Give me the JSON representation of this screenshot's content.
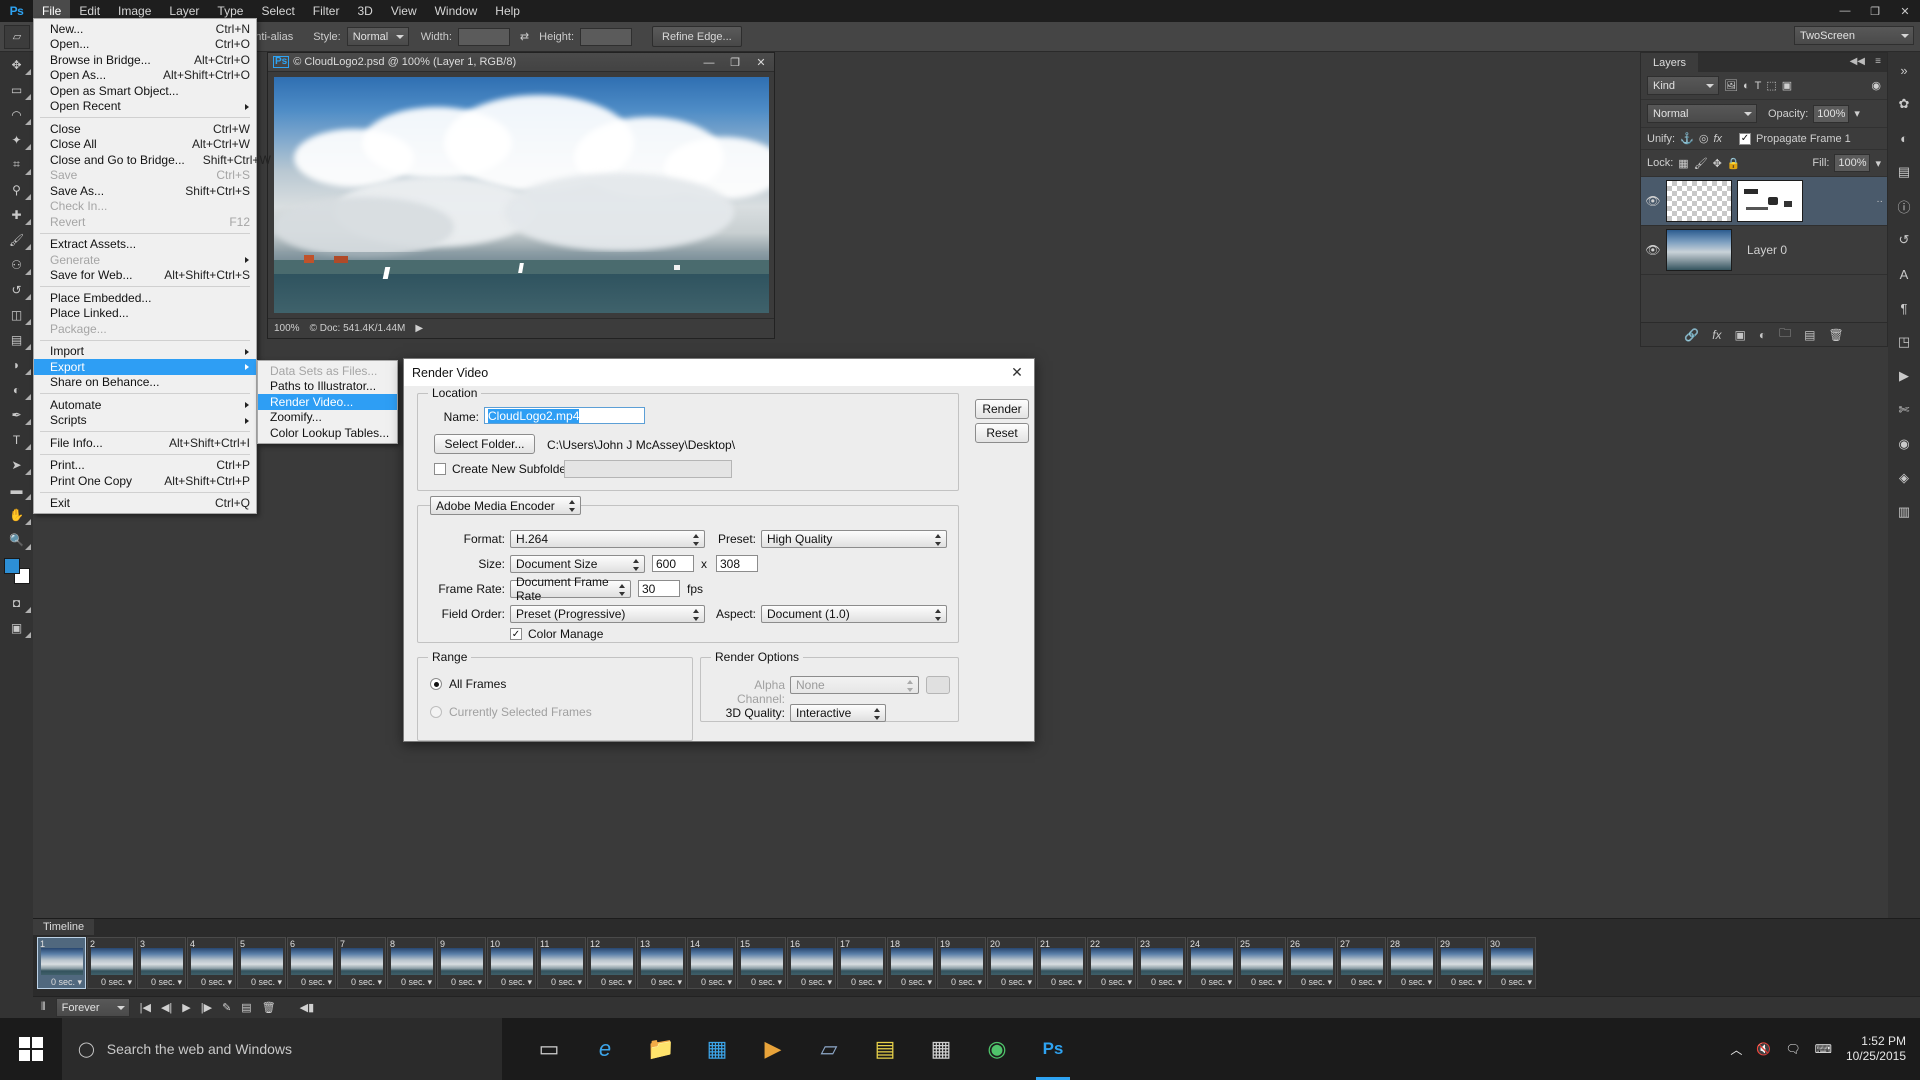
{
  "app": {
    "name": "Adobe Photoshop",
    "logo": "Ps"
  },
  "menubar": {
    "items": [
      "File",
      "Edit",
      "Image",
      "Layer",
      "Type",
      "Select",
      "Filter",
      "3D",
      "View",
      "Window",
      "Help"
    ],
    "active": "File",
    "window_buttons": [
      "minimize",
      "restore",
      "close"
    ]
  },
  "options_bar": {
    "antialias_label": "Anti-alias",
    "style_label": "Style:",
    "style_value": "Normal",
    "width_label": "Width:",
    "width_value": "",
    "height_label": "Height:",
    "height_value": "",
    "refine_edge_label": "Refine Edge...",
    "workspace_value": "TwoScreen"
  },
  "file_menu": {
    "groups": [
      [
        {
          "label": "New...",
          "accel": "Ctrl+N",
          "disabled": false,
          "submenu": false
        },
        {
          "label": "Open...",
          "accel": "Ctrl+O",
          "disabled": false,
          "submenu": false
        },
        {
          "label": "Browse in Bridge...",
          "accel": "Alt+Ctrl+O",
          "disabled": false,
          "submenu": false
        },
        {
          "label": "Open As...",
          "accel": "Alt+Shift+Ctrl+O",
          "disabled": false,
          "submenu": false
        },
        {
          "label": "Open as Smart Object...",
          "accel": "",
          "disabled": false,
          "submenu": false
        },
        {
          "label": "Open Recent",
          "accel": "",
          "disabled": false,
          "submenu": true
        }
      ],
      [
        {
          "label": "Close",
          "accel": "Ctrl+W",
          "disabled": false,
          "submenu": false
        },
        {
          "label": "Close All",
          "accel": "Alt+Ctrl+W",
          "disabled": false,
          "submenu": false
        },
        {
          "label": "Close and Go to Bridge...",
          "accel": "Shift+Ctrl+W",
          "disabled": false,
          "submenu": false
        },
        {
          "label": "Save",
          "accel": "Ctrl+S",
          "disabled": true,
          "submenu": false
        },
        {
          "label": "Save As...",
          "accel": "Shift+Ctrl+S",
          "disabled": false,
          "submenu": false
        },
        {
          "label": "Check In...",
          "accel": "",
          "disabled": true,
          "submenu": false
        },
        {
          "label": "Revert",
          "accel": "F12",
          "disabled": true,
          "submenu": false
        }
      ],
      [
        {
          "label": "Extract Assets...",
          "accel": "",
          "disabled": false,
          "submenu": false
        },
        {
          "label": "Generate",
          "accel": "",
          "disabled": true,
          "submenu": true
        },
        {
          "label": "Save for Web...",
          "accel": "Alt+Shift+Ctrl+S",
          "disabled": false,
          "submenu": false
        }
      ],
      [
        {
          "label": "Place Embedded...",
          "accel": "",
          "disabled": false,
          "submenu": false
        },
        {
          "label": "Place Linked...",
          "accel": "",
          "disabled": false,
          "submenu": false
        },
        {
          "label": "Package...",
          "accel": "",
          "disabled": true,
          "submenu": false
        }
      ],
      [
        {
          "label": "Import",
          "accel": "",
          "disabled": false,
          "submenu": true
        },
        {
          "label": "Export",
          "accel": "",
          "disabled": false,
          "submenu": true,
          "highlighted": true
        },
        {
          "label": "Share on Behance...",
          "accel": "",
          "disabled": false,
          "submenu": false
        }
      ],
      [
        {
          "label": "Automate",
          "accel": "",
          "disabled": false,
          "submenu": true
        },
        {
          "label": "Scripts",
          "accel": "",
          "disabled": false,
          "submenu": true
        }
      ],
      [
        {
          "label": "File Info...",
          "accel": "Alt+Shift+Ctrl+I",
          "disabled": false,
          "submenu": false
        }
      ],
      [
        {
          "label": "Print...",
          "accel": "Ctrl+P",
          "disabled": false,
          "submenu": false
        },
        {
          "label": "Print One Copy",
          "accel": "Alt+Shift+Ctrl+P",
          "disabled": false,
          "submenu": false
        }
      ],
      [
        {
          "label": "Exit",
          "accel": "Ctrl+Q",
          "disabled": false,
          "submenu": false
        }
      ]
    ]
  },
  "export_submenu": {
    "items": [
      {
        "label": "Data Sets as Files...",
        "disabled": true,
        "highlighted": false
      },
      {
        "label": "Paths to Illustrator...",
        "disabled": false,
        "highlighted": false
      },
      {
        "label": "Render Video...",
        "disabled": false,
        "highlighted": true
      },
      {
        "label": "Zoomify...",
        "disabled": false,
        "highlighted": false
      },
      {
        "label": "Color Lookup Tables...",
        "disabled": false,
        "highlighted": false
      }
    ]
  },
  "document_window": {
    "title": "© CloudLogo2.psd @ 100% (Layer 1, RGB/8)",
    "badge": "Ps",
    "zoom": "100%",
    "doc_info": "© Doc: 541.4K/1.44M",
    "window_buttons": [
      "minimize",
      "restore",
      "close"
    ]
  },
  "layers_panel": {
    "tab_label": "Layers",
    "filter_kind": "Kind",
    "filter_icons": [
      "image-filter-icon",
      "adjustment-filter-icon",
      "type-filter-icon",
      "shape-filter-icon",
      "smart-object-filter-icon"
    ],
    "blend_mode": "Normal",
    "opacity_label": "Opacity:",
    "opacity_value": "100%",
    "unify_label": "Unify:",
    "unify_icons": [
      "unify-position-icon",
      "unify-visibility-icon",
      "unify-style-icon"
    ],
    "propagate_label": "Propagate Frame 1",
    "propagate_checked": true,
    "lock_label": "Lock:",
    "lock_icons": [
      "lock-transparent-icon",
      "lock-image-icon",
      "lock-position-icon",
      "lock-all-icon"
    ],
    "fill_label": "Fill:",
    "fill_value": "100%",
    "layers": [
      {
        "name": "",
        "selected": true,
        "visible": true,
        "thumb": "transparent",
        "has_mask": true
      },
      {
        "name": "Layer 0",
        "selected": false,
        "visible": true,
        "thumb": "photo",
        "has_mask": false
      }
    ],
    "footer_icons": [
      "link-layers-icon",
      "layer-style-icon",
      "layer-mask-icon",
      "adjustment-layer-icon",
      "new-group-icon",
      "new-layer-icon",
      "delete-layer-icon"
    ]
  },
  "dialog": {
    "title": "Render Video",
    "close_icon": "close-icon",
    "buttons": {
      "render": "Render",
      "reset": "Reset"
    },
    "location": {
      "group_title": "Location",
      "name_label": "Name:",
      "name_value": "CloudLogo2.mp4",
      "select_folder_label": "Select Folder...",
      "folder_path": "C:\\Users\\John J McAssey\\Desktop\\",
      "create_subfolder_label": "Create New Subfolder:",
      "create_subfolder_checked": false,
      "subfolder_value": ""
    },
    "encoder": {
      "engine": "Adobe Media Encoder",
      "format_label": "Format:",
      "format_value": "H.264",
      "preset_label": "Preset:",
      "preset_value": "High Quality",
      "size_label": "Size:",
      "size_value": "Document Size",
      "width_value": "600",
      "size_separator": "x",
      "height_value": "308",
      "frame_rate_label": "Frame Rate:",
      "frame_rate_value": "Document Frame Rate",
      "fps_value": "30",
      "fps_unit": "fps",
      "field_order_label": "Field Order:",
      "field_order_value": "Preset (Progressive)",
      "aspect_label": "Aspect:",
      "aspect_value": "Document (1.0)",
      "color_manage_label": "Color Manage",
      "color_manage_checked": true
    },
    "range": {
      "group_title": "Range",
      "options": [
        {
          "label": "All Frames",
          "selected": true,
          "disabled": false
        },
        {
          "label": "Currently Selected Frames",
          "selected": false,
          "disabled": true
        }
      ]
    },
    "render_options": {
      "group_title": "Render Options",
      "alpha_label": "Alpha Channel:",
      "alpha_value": "None",
      "alpha_disabled": true,
      "quality_label": "3D Quality:",
      "quality_value": "Interactive"
    }
  },
  "timeline": {
    "tab_label": "Timeline",
    "frame_count": 30,
    "selected_frame": 1,
    "frame_duration": "0 sec.",
    "loop_value": "Forever",
    "controls": [
      "select-first-frame-icon",
      "previous-frame-icon",
      "play-icon",
      "next-frame-icon",
      "tween-icon",
      "duplicate-frame-icon",
      "delete-frame-icon"
    ]
  },
  "taskbar": {
    "start_icon": "windows-start-icon",
    "search_placeholder": "Search the web and Windows",
    "search_icon": "search-icon",
    "apps": [
      {
        "name": "task-view-icon",
        "glyph": "▭",
        "active": false
      },
      {
        "name": "edge-browser-icon",
        "glyph": "e",
        "active": false
      },
      {
        "name": "file-explorer-icon",
        "glyph": "📁",
        "active": false
      },
      {
        "name": "store-icon",
        "glyph": "▦",
        "active": false
      },
      {
        "name": "media-player-icon",
        "glyph": "▶",
        "active": false
      },
      {
        "name": "video-editor-icon",
        "glyph": "▱",
        "active": false
      },
      {
        "name": "notes-icon",
        "glyph": "▤",
        "active": false
      },
      {
        "name": "calculator-icon",
        "glyph": "▦",
        "active": false
      },
      {
        "name": "chrome-icon",
        "glyph": "◉",
        "active": false
      },
      {
        "name": "photoshop-icon",
        "glyph": "Ps",
        "active": true
      }
    ],
    "tray": {
      "show_hidden_icon": "chevron-up-icon",
      "volume_icon": "volume-muted-icon",
      "action_center_icon": "notification-icon",
      "keyboard_icon": "keyboard-icon",
      "time": "1:52 PM",
      "date": "10/25/2015"
    }
  },
  "tools": [
    "move-tool",
    "marquee-tool",
    "lasso-tool",
    "quick-select-tool",
    "crop-tool",
    "eyedropper-tool",
    "healing-brush-tool",
    "brush-tool",
    "clone-stamp-tool",
    "history-brush-tool",
    "eraser-tool",
    "gradient-tool",
    "blur-tool",
    "dodge-tool",
    "pen-tool",
    "type-tool",
    "path-select-tool",
    "shape-tool",
    "hand-tool",
    "zoom-tool"
  ],
  "right_dock": [
    "collapse-icon",
    "color-panel-icon",
    "adjustments-panel-icon",
    "libraries-panel-icon",
    "info-panel-icon",
    "history-panel-icon",
    "character-panel-icon",
    "paragraph-panel-icon",
    "styles-panel-icon",
    "actions-panel-icon",
    "scissors-icon",
    "properties-panel-icon",
    "navigator-panel-icon",
    "channels-panel-icon"
  ],
  "colors": {
    "accent": "#2e9ef4",
    "panel_bg": "#3c3c3c",
    "dialog_bg": "#ededed",
    "foreground_swatch": "#2d8fd5",
    "background_swatch": "#ffffff"
  }
}
